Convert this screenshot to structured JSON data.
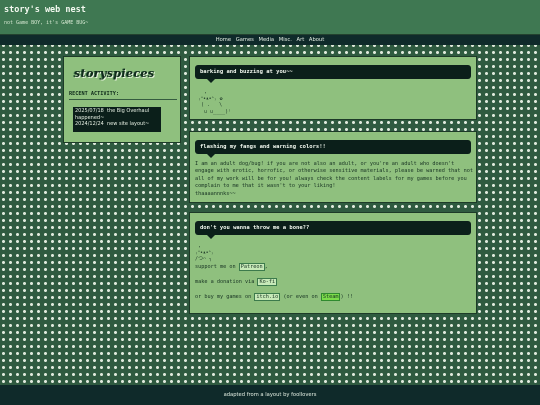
{
  "header": {
    "title": "story's web nest",
    "tagline": "not Game BOY, it's GAME BUG~"
  },
  "nav": [
    "Home",
    "Games",
    "Media",
    "Misc.",
    "Art",
    "About"
  ],
  "sidebar": {
    "logo": "storyspieces",
    "activity_heading": "RECENT ACTIVITY:",
    "activity": [
      {
        "date": "2025/07/18",
        "text": "the Big Overhaul happened~"
      },
      {
        "date": "2024/12/24",
        "text": "new site layout~"
      }
    ]
  },
  "panels": [
    {
      "heading": "barking and buzzing at you~~",
      "ascii": "   ,\n ₍ᐢ•ᴥ•ᐢ₎ ✿ \n  ( .   \\\n   ∪ ∪____)⁾"
    },
    {
      "heading": "flashing my fangs and warning colors!!",
      "text": "I am an adult dog/bug! if you are not also an adult, or you're an adult who doesn't engage with erotic, horrofic, or otherwise sensitive materials, please be warned that not all of my work will be for you! always check the content labels for my games before you complain to me that it wasn't to your liking!",
      "signoff": "thaaaannnks~~"
    },
    {
      "heading": "don't you wanna throw me a bone??",
      "ascii": " ,\n₍ᐢ•ᴥ•ᐢ₎\n/つ⌒ ╮",
      "line1_prefix": "support me on ",
      "line1_link": "Patreon",
      "line1_suffix": ",",
      "line2_prefix": "make a donation via ",
      "line2_link": "Ko-fi",
      "line3_prefix": "or buy my games on ",
      "line3_link": "itch.io",
      "line3_middle": " (or even on ",
      "line3_link2": "Steam",
      "line3_suffix": ") !!"
    }
  ],
  "footer": "adapted from a layout by foollovers",
  "colors": {
    "background": "#2f5a40",
    "panel": "#8fc07e",
    "dark": "#0b1f1a",
    "header": "#3f7852"
  }
}
